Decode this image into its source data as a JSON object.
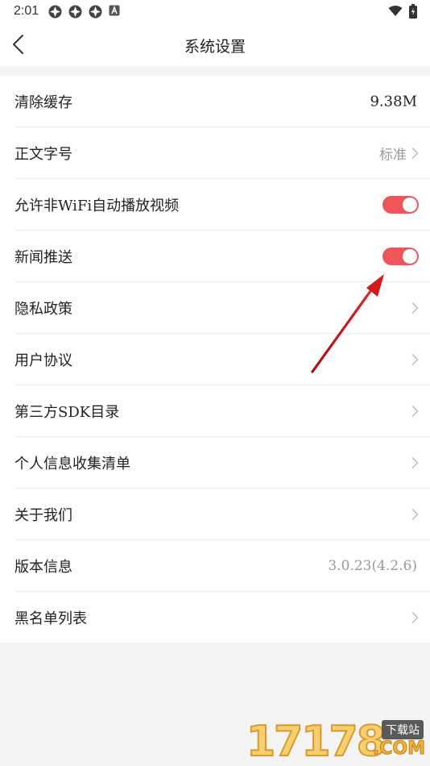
{
  "status_bar": {
    "time": "2:01",
    "notification_icons": [
      "app-icon",
      "app-icon",
      "app-icon",
      "a-icon"
    ],
    "right_icons": [
      "wifi-icon",
      "battery-icon"
    ]
  },
  "header": {
    "title": "系统设置",
    "back_icon": "chevron-left-icon"
  },
  "settings": [
    {
      "id": "clear-cache",
      "label": "清除缓存",
      "kind": "value",
      "value": "9.38M"
    },
    {
      "id": "font-size",
      "label": "正文字号",
      "kind": "nav",
      "value": "标准"
    },
    {
      "id": "autoplay",
      "label": "允许非WiFi自动播放视频",
      "kind": "toggle",
      "on": true
    },
    {
      "id": "news-push",
      "label": "新闻推送",
      "kind": "toggle",
      "on": true
    },
    {
      "id": "privacy",
      "label": "隐私政策",
      "kind": "nav"
    },
    {
      "id": "agreement",
      "label": "用户协议",
      "kind": "nav"
    },
    {
      "id": "sdk-list",
      "label": "第三方SDK目录",
      "kind": "nav"
    },
    {
      "id": "info-list",
      "label": "个人信息收集清单",
      "kind": "nav"
    },
    {
      "id": "about",
      "label": "关于我们",
      "kind": "nav"
    },
    {
      "id": "version",
      "label": "版本信息",
      "kind": "value",
      "value": "3.0.23(4.2.6)"
    },
    {
      "id": "blacklist",
      "label": "黑名单列表",
      "kind": "nav"
    }
  ],
  "colors": {
    "toggle_on": "#f0545b",
    "annotation_arrow": "#d21a1a",
    "secondary_text": "#999999"
  },
  "watermark": {
    "number": "17178",
    "tag": "下载站",
    "suffix": ".COM"
  }
}
